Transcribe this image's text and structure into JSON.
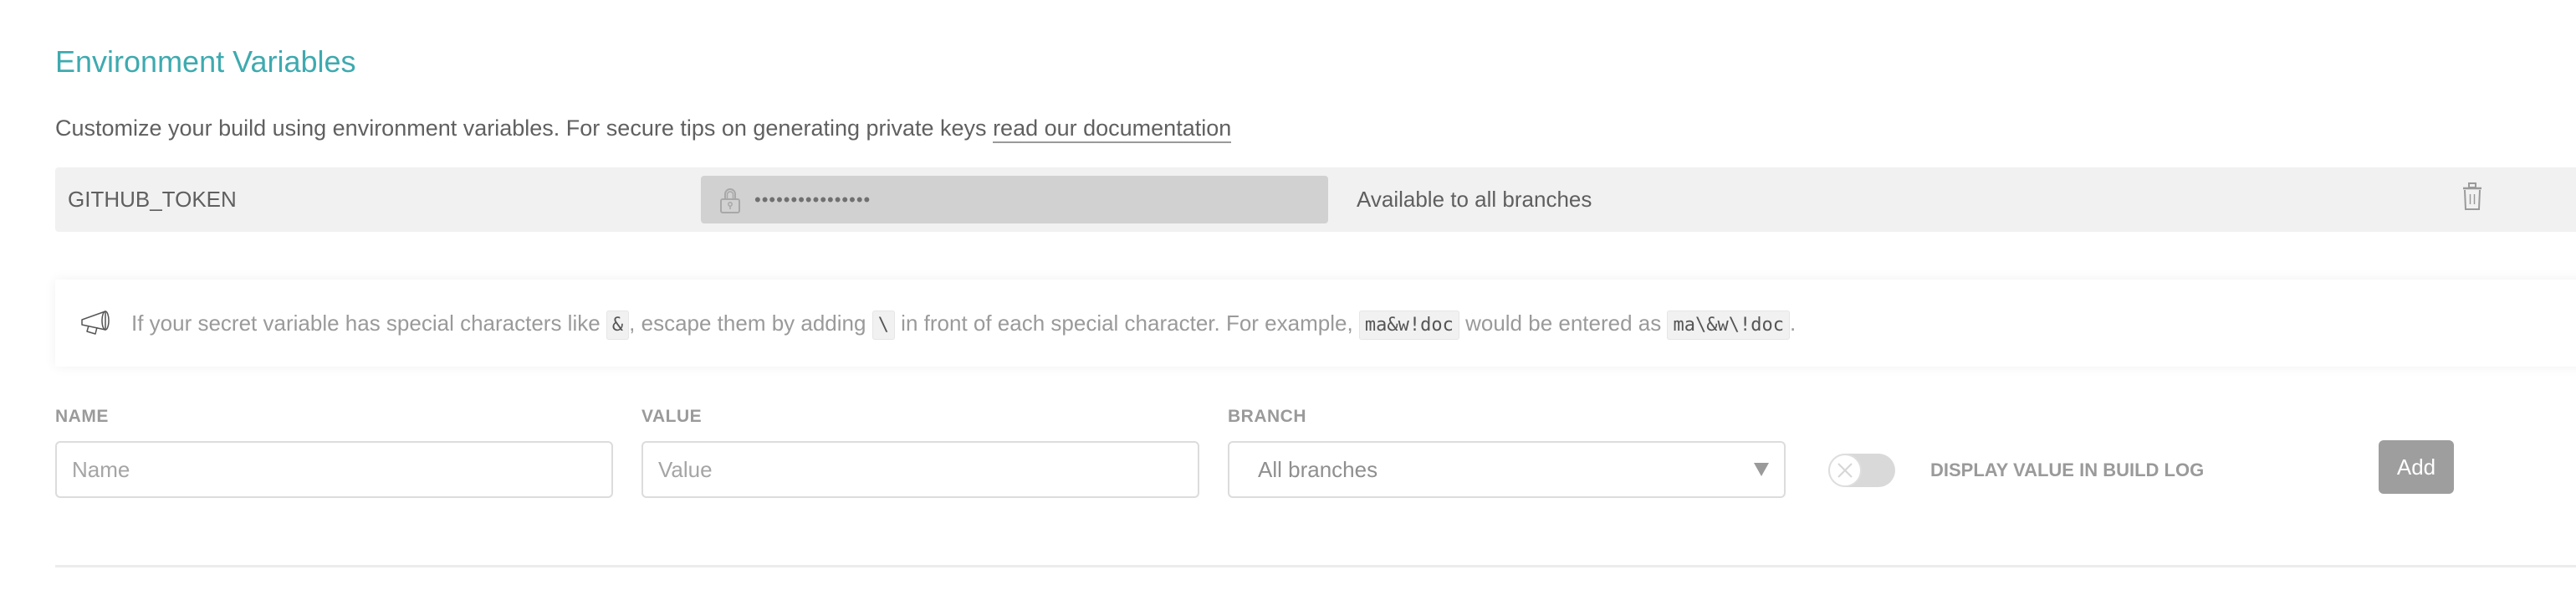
{
  "section": {
    "title": "Environment Variables",
    "description_prefix": "Customize your build using environment variables. For secure tips on generating private keys ",
    "documentation_link": "read our documentation",
    "accent_color": "#3eaaaf"
  },
  "variables": [
    {
      "name": "GITHUB_TOKEN",
      "value_masked": "••••••••••••••••",
      "branch": "Available to all branches",
      "lock_icon": "lock-icon",
      "delete_icon": "trash-icon"
    }
  ],
  "notice": {
    "icon": "megaphone-icon",
    "text_1": "If your secret variable has special characters like ",
    "code_1": "&",
    "text_2": ", escape them by adding ",
    "code_2": "\\",
    "text_3": " in front of each special character. For example, ",
    "code_3": "ma&w!doc",
    "text_4": " would be entered as ",
    "code_4": "ma\\&w\\!doc",
    "text_5": "."
  },
  "form": {
    "name_label": "NAME",
    "name_placeholder": "Name",
    "name_value": "",
    "value_label": "VALUE",
    "value_placeholder": "Value",
    "value_value": "",
    "branch_label": "BRANCH",
    "branch_selected": "All branches",
    "display_toggle_on": false,
    "display_label": "DISPLAY VALUE IN BUILD LOG",
    "add_label": "Add"
  }
}
